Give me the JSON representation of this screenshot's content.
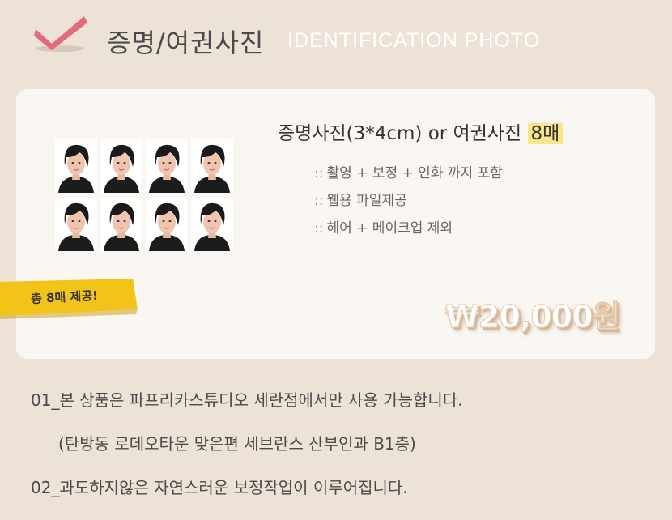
{
  "header": {
    "title_ko": "증명/여권사진",
    "title_en": "IDENTIFICATION PHOTO"
  },
  "product": {
    "title": "증명사진(3*4cm) or 여권사진",
    "count": "8매",
    "bullet": "::",
    "features": [
      "촬영 + 보정 + 인화 까지 포함",
      "웹용 파일제공",
      "헤어 + 메이크업 제외"
    ]
  },
  "badge": {
    "text": "총 8매 제공!"
  },
  "price": "₩20,000원",
  "notes": [
    "01_본 상품은 파프리카스튜디오 세란점에서만 사용 가능합니다.",
    "(탄방동 로데오타운 맞은편 세브란스 산부인과 B1층)",
    "02_과도하지않은 자연스러운 보정작업이 이루어집니다."
  ],
  "colors": {
    "background": "#ede2d6",
    "card": "#faf7f3",
    "check": "#e46a78",
    "highlight": "#fce58a",
    "ribbon": "#f2c318"
  },
  "icons": {
    "check": "check-icon"
  }
}
